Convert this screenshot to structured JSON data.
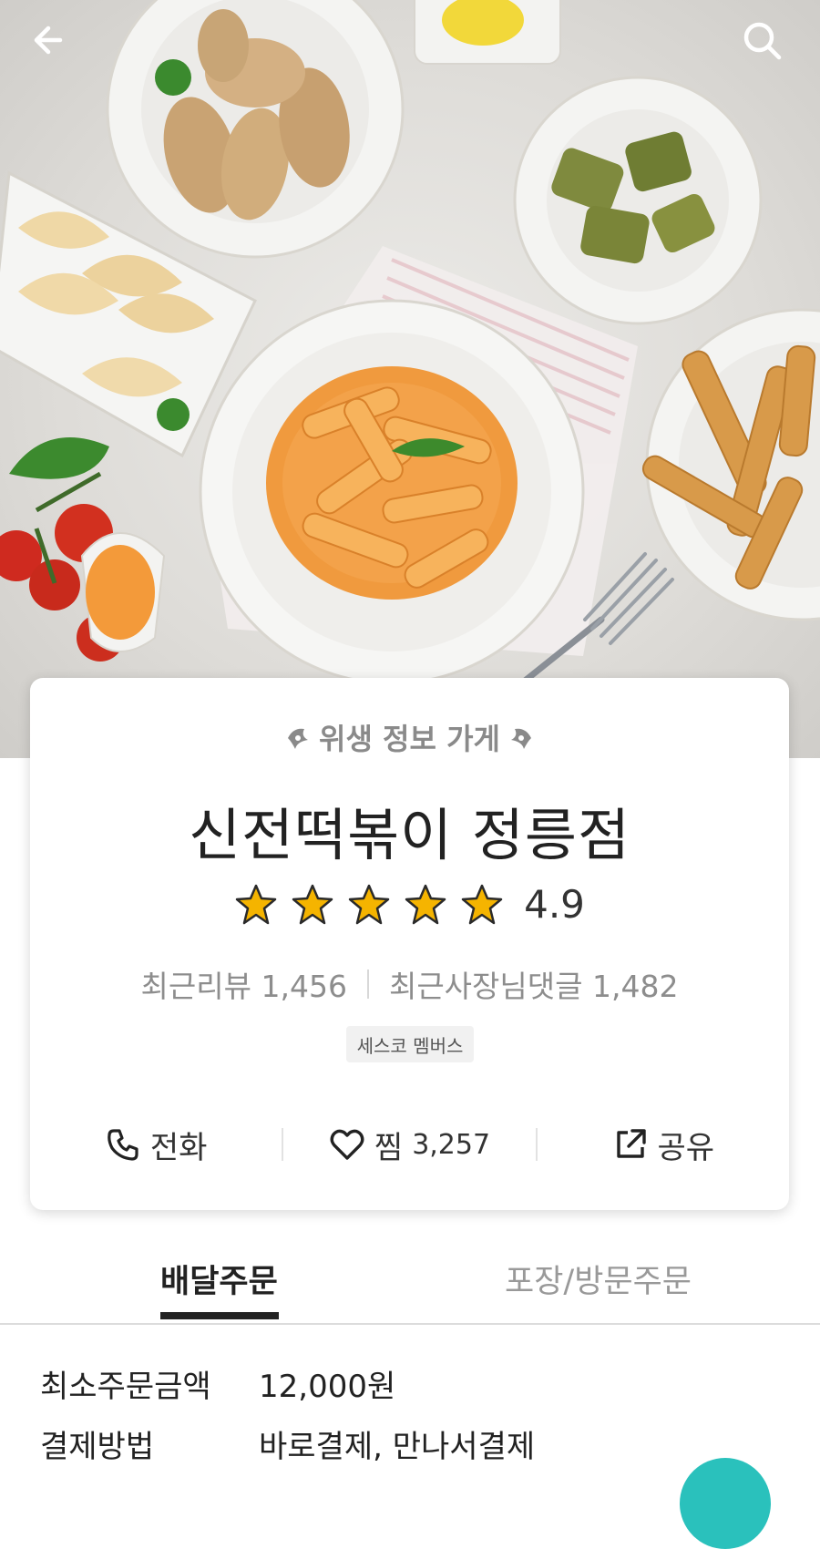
{
  "header": {
    "back_icon": "arrow-left-icon",
    "search_icon": "search-icon"
  },
  "store": {
    "hygiene_label": "위생 정보 가게",
    "name": "신전떡볶이 정릉점",
    "rating": "4.9",
    "rating_stars": 5,
    "recent_reviews_label": "최근리뷰 1,456",
    "recent_owner_replies_label": "최근사장님댓글 1,482",
    "member_badge": "세스코 멤버스",
    "actions": {
      "call_label": "전화",
      "like_label": "찜",
      "like_count": "3,257",
      "share_label": "공유"
    }
  },
  "tabs": {
    "delivery_label": "배달주문",
    "pickup_label": "포장/방문주문",
    "selected": "delivery"
  },
  "info": {
    "min_order_label": "최소주문금액",
    "min_order_value": "12,000원",
    "payment_label": "결제방법",
    "payment_value": "바로결제, 만나서결제"
  },
  "colors": {
    "accent": "#2ac1bc",
    "star": "#f5b400",
    "text_muted": "#8d8d8d"
  }
}
